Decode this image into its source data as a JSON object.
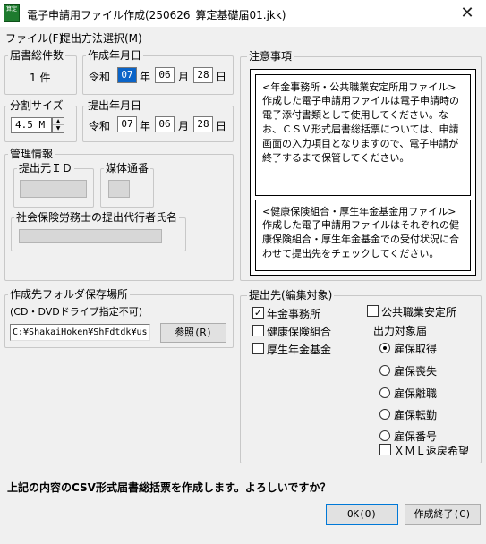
{
  "window": {
    "title": "電子申請用ファイル作成(250626_算定基礎届01.jkk)",
    "app_icon_text": "算定"
  },
  "menu": {
    "items": [
      {
        "label": "ファイル(F)"
      },
      {
        "label": "提出方法選択(M)"
      }
    ]
  },
  "total_count": {
    "label": "届書総件数",
    "value": "1 件"
  },
  "created_date": {
    "label": "作成年月日",
    "era": "令和",
    "year": "07",
    "year_unit": "年",
    "month": "06",
    "month_unit": "月",
    "day": "28",
    "day_unit": "日"
  },
  "split_size": {
    "label": "分割サイズ",
    "value": "4.5 M"
  },
  "submit_date": {
    "label": "提出年月日",
    "era": "令和",
    "year": "07",
    "year_unit": "年",
    "month": "06",
    "month_unit": "月",
    "day": "28",
    "day_unit": "日"
  },
  "management": {
    "label": "管理情報",
    "submitter_id_label": "提出元ＩＤ",
    "media_number_label": "媒体通番",
    "agent_name_label": "社会保険労務士の提出代行者氏名"
  },
  "notice": {
    "label": "注意事項",
    "section1_heading": "<年金事務所・公共職業安定所用ファイル>",
    "section1_text": "作成した電子申請用ファイルは電子申請時の電子添付書類として使用してください。なお、ＣＳＶ形式届書総括票については、申請画面の入力項目となりますので、電子申請が終了するまで保管してください。",
    "section2_heading": "<健康保険組合・厚生年金基金用ファイル>",
    "section2_text": "作成した電子申請用ファイルはそれぞれの健康保険組合・厚生年金基金での受付状況に合わせて提出先をチェックしてください。"
  },
  "folder": {
    "label": "作成先フォルダ保存場所",
    "note": "(CD・DVDドライブ指定不可)",
    "path": "C:¥ShakaiHoken¥ShFdtdk¥us",
    "browse_label": "参照(R)"
  },
  "destination": {
    "label": "提出先(編集対象)",
    "pension_office": {
      "label": "年金事務所",
      "checked": true
    },
    "health_union": {
      "label": "健康保険組合",
      "checked": false
    },
    "pension_fund": {
      "label": "厚生年金基金",
      "checked": false
    },
    "employment_office": {
      "label": "公共職業安定所",
      "checked": false
    },
    "output_label": "出力対象届",
    "radios": [
      {
        "label": "雇保取得",
        "selected": true
      },
      {
        "label": "雇保喪失",
        "selected": false
      },
      {
        "label": "雇保離職",
        "selected": false
      },
      {
        "label": "雇保転勤",
        "selected": false
      },
      {
        "label": "雇保番号",
        "selected": false
      }
    ],
    "xml_return": {
      "label": "ＸＭＬ返戻希望",
      "checked": false
    }
  },
  "confirm_message": "上記の内容のCSV形式届書総括票を作成します。よろしいですか？",
  "buttons": {
    "ok_label": "OK(O)",
    "exit_label": "作成終了(C)"
  }
}
